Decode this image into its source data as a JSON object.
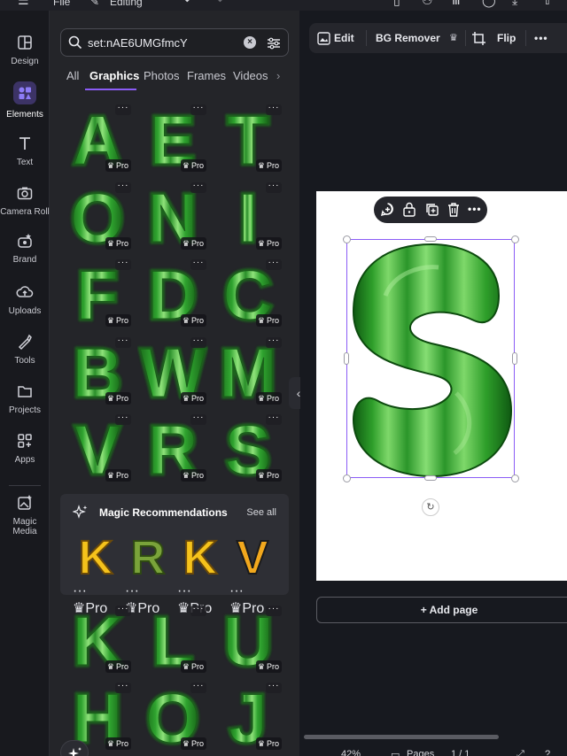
{
  "topbar": {
    "file_label": "File",
    "mode_label": "Editing"
  },
  "rail": {
    "items": [
      {
        "label": "Design",
        "icon": "design-icon"
      },
      {
        "label": "Elements",
        "icon": "elements-icon"
      },
      {
        "label": "Text",
        "icon": "text-icon"
      },
      {
        "label": "Camera Roll",
        "icon": "camera-icon"
      },
      {
        "label": "Brand",
        "icon": "brand-icon"
      },
      {
        "label": "Uploads",
        "icon": "uploads-icon"
      },
      {
        "label": "Tools",
        "icon": "tools-icon"
      },
      {
        "label": "Projects",
        "icon": "projects-icon"
      },
      {
        "label": "Apps",
        "icon": "apps-icon"
      },
      {
        "label": "Magic Media",
        "icon": "magic-media-icon"
      }
    ]
  },
  "search": {
    "value": "set:nAE6UMGfmcY"
  },
  "tabs": [
    "All",
    "Graphics",
    "Photos",
    "Frames",
    "Videos"
  ],
  "pro_label": "Pro",
  "grid1": [
    "A",
    "E",
    "T",
    "O",
    "N",
    "I",
    "F",
    "D",
    "C",
    "B",
    "W",
    "M",
    "V",
    "R",
    "S"
  ],
  "magic": {
    "title": "Magic Recommendations",
    "see_all": "See all",
    "items": [
      "K",
      "R",
      "K",
      "V"
    ]
  },
  "grid2": [
    "K",
    "L",
    "U",
    "H",
    "O",
    "J"
  ],
  "toolbar": {
    "edit_label": "Edit",
    "bg_remover_label": "BG Remover",
    "flip_label": "Flip"
  },
  "canvas": {
    "selected_letter": "S",
    "add_page_label": "+ Add page"
  },
  "status": {
    "zoom": "42%",
    "pages_label": "Pages",
    "page_count": "1 / 1"
  },
  "colors": {
    "accent": "#8b5cf6",
    "watermelon_dark": "#1f7a1f",
    "watermelon_light": "#7fdc6e"
  }
}
